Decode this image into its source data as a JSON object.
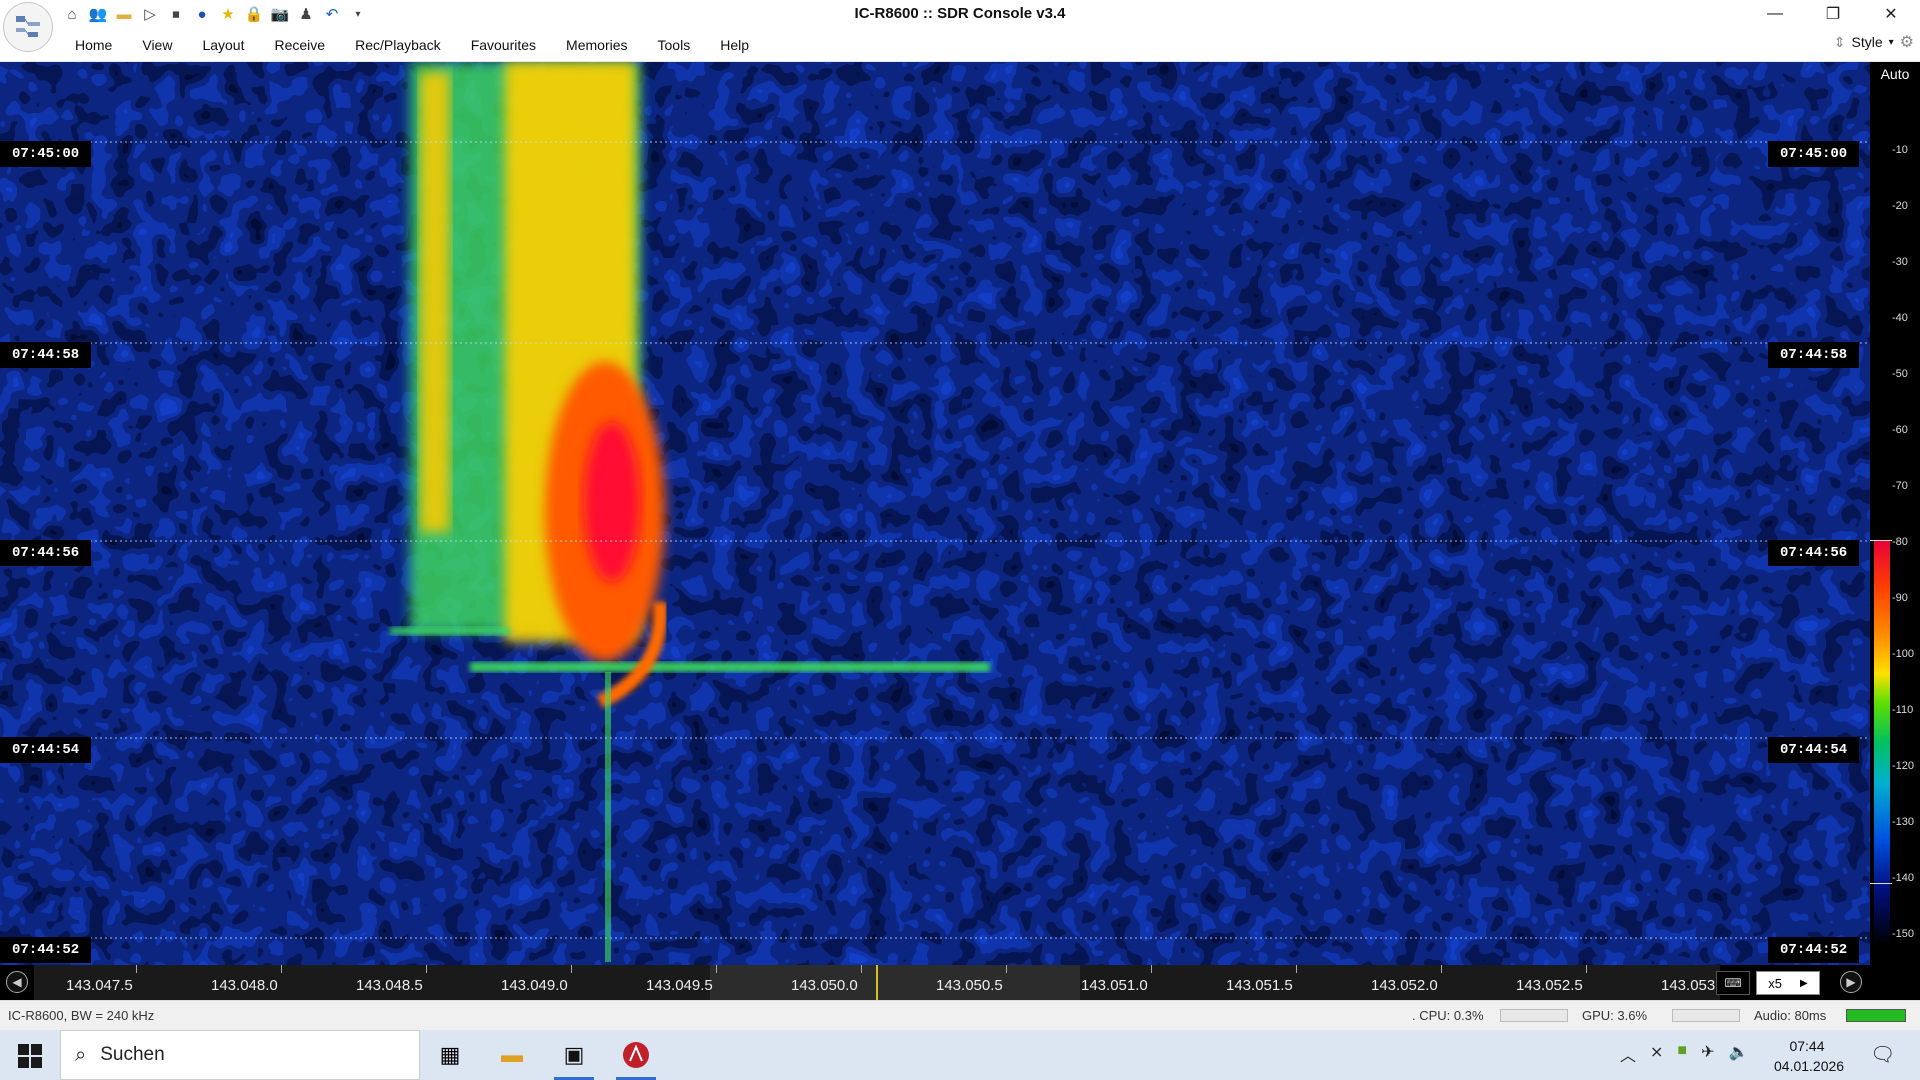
{
  "title": "IC-R8600 :: SDR Console v3.4",
  "quick_access": [
    "home-icon",
    "users-icon",
    "folder-icon",
    "play-icon",
    "stop-icon",
    "record-icon",
    "star-icon",
    "lock-icon",
    "camera-icon",
    "user-icon",
    "undo-icon",
    "dropdown-icon"
  ],
  "menu": [
    "Home",
    "View",
    "Layout",
    "Receive",
    "Rec/Playback",
    "Favourites",
    "Memories",
    "Tools",
    "Help"
  ],
  "style_label": "Style",
  "scale": {
    "auto_label": "Auto",
    "ticks": [
      "-10",
      "-20",
      "-30",
      "-40",
      "-50",
      "-60",
      "-70",
      "-80",
      "-90",
      "-100",
      "-110",
      "-120",
      "-130",
      "-140",
      "-150"
    ]
  },
  "waterfall": {
    "time_labels": [
      "07:45:00",
      "07:44:58",
      "07:44:56",
      "07:44:54",
      "07:44:52"
    ]
  },
  "freq": {
    "labels": [
      "143.047.5",
      "143.048.0",
      "143.048.5",
      "143.049.0",
      "143.049.5",
      "143.050.0",
      "143.050.5",
      "143.051.0",
      "143.051.5",
      "143.052.0",
      "143.052.5",
      "143.053"
    ],
    "zoom": "x5"
  },
  "status": {
    "device": "IC-R8600, BW = 240 kHz",
    "cpu": ". CPU: 0.3%",
    "gpu": "GPU: 3.6%",
    "audio": "Audio: 80ms"
  },
  "taskbar": {
    "search_placeholder": "Suchen",
    "time": "07:44",
    "date": "04.01.2026"
  }
}
